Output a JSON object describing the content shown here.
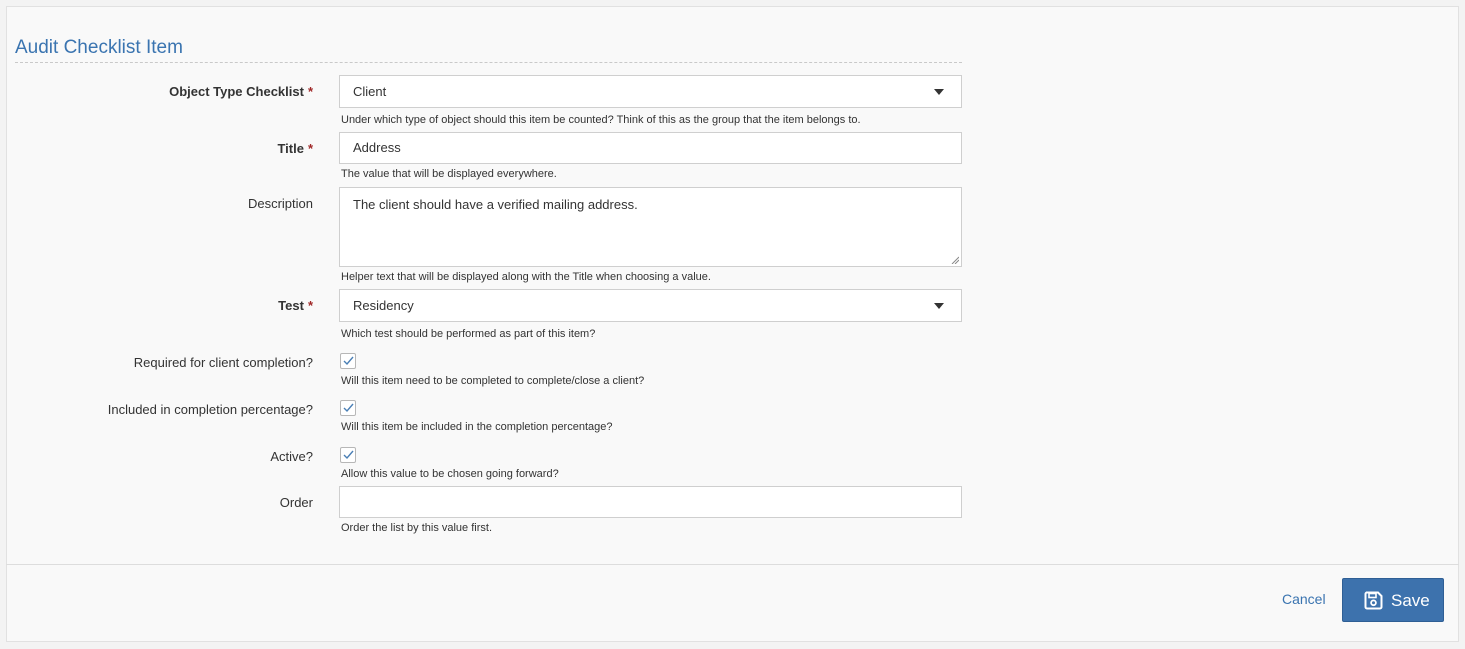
{
  "page": {
    "title": "Audit Checklist Item"
  },
  "form": {
    "required_marker": "*",
    "object_type": {
      "label": "Object Type Checklist",
      "value": "Client",
      "help": "Under which type of object should this item be counted? Think of this as the group that the item belongs to."
    },
    "title": {
      "label": "Title",
      "value": "Address",
      "help": "The value that will be displayed everywhere."
    },
    "description": {
      "label": "Description",
      "value": "The client should have a verified mailing address.",
      "help": "Helper text that will be displayed along with the Title when choosing a value."
    },
    "test": {
      "label": "Test",
      "value": "Residency",
      "help": "Which test should be performed as part of this item?"
    },
    "required_for_completion": {
      "label": "Required for client completion?",
      "checked": true,
      "help": "Will this item need to be completed to complete/close a client?"
    },
    "included_in_percentage": {
      "label": "Included in completion percentage?",
      "checked": true,
      "help": "Will this item be included in the completion percentage?"
    },
    "active": {
      "label": "Active?",
      "checked": true,
      "help": "Allow this value to be chosen going forward?"
    },
    "order": {
      "label": "Order",
      "value": "",
      "help": "Order the list by this value first."
    }
  },
  "footer": {
    "cancel_label": "Cancel",
    "save_label": "Save"
  },
  "colors": {
    "accent": "#3a74b0",
    "save_button": "#3d72ad",
    "required": "#a02828"
  },
  "icons": {
    "dropdown": "caret-down-icon",
    "check": "checkmark-icon",
    "save": "floppy-disk-icon"
  }
}
